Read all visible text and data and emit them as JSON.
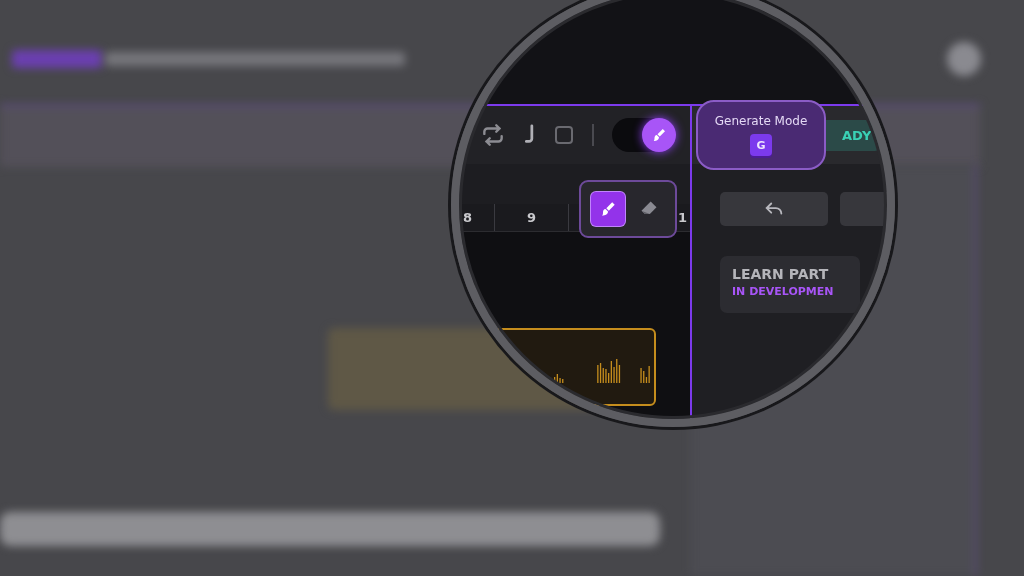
{
  "toolbar": {
    "paint_toggle": {
      "on": true
    }
  },
  "ruler": {
    "labels": [
      "8",
      "9",
      "1"
    ]
  },
  "tool_popover": {
    "tools": [
      {
        "kind": "brush",
        "selected": true
      },
      {
        "kind": "eraser",
        "selected": false
      }
    ]
  },
  "tooltip": {
    "title": "Generate Mode",
    "key": "G"
  },
  "status_badge": {
    "text": "ADY"
  },
  "learn_card": {
    "title": "LEARN PART",
    "status": "IN DEVELOPMEN"
  }
}
